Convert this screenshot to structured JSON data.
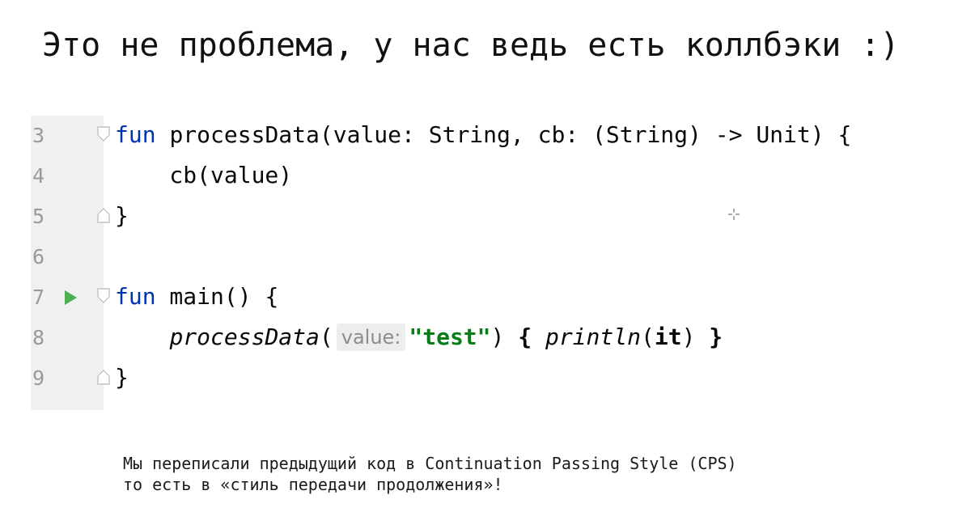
{
  "slide": {
    "title": "Это не проблема, у нас ведь есть коллбэки :)"
  },
  "editor": {
    "lines": [
      {
        "number": "3",
        "tokens": {
          "kw": "fun",
          "sp": " ",
          "name": "processData",
          "rest": "(value: String, cb: (String) -> Unit) {"
        }
      },
      {
        "number": "4",
        "text": "    cb(value)"
      },
      {
        "number": "5",
        "text": "}"
      },
      {
        "number": "6",
        "text": ""
      },
      {
        "number": "7",
        "tokens": {
          "kw": "fun",
          "rest": " main() {"
        }
      },
      {
        "number": "8",
        "tokens": {
          "indent": "    ",
          "call": "processData",
          "open": "(",
          "hint": "value:",
          "str": "\"test\"",
          "close": ") ",
          "brace_open": "{",
          "sp": " ",
          "println": "println",
          "p_open": "(",
          "it": "it",
          "p_close": ")",
          "sp2": " ",
          "brace_close": "}"
        }
      },
      {
        "number": "9",
        "text": "}"
      }
    ],
    "icons": {
      "run": "run-gutter-icon",
      "fold": "fold-marker-icon",
      "cursor": "crosshair-cursor-icon"
    },
    "colors": {
      "keyword": "#0033b3",
      "string": "#067d17",
      "run": "#4caf50",
      "gutter_bg": "#f0f0f0",
      "line_number": "#9a9a9a",
      "hint_bg": "#ededed"
    }
  },
  "caption": {
    "line1": "Мы переписали предыдущий код в Continuation Passing Style (CPS)",
    "line2": "то есть в «стиль передачи продолжения»!"
  }
}
